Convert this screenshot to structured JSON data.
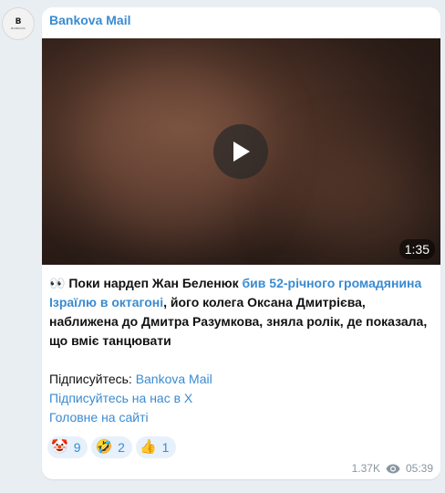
{
  "channel": {
    "sender": "Bankova Mail",
    "avatar_letter": "B",
    "avatar_text": "BANKOVA"
  },
  "video": {
    "duration": "1:35"
  },
  "post": {
    "emoji_lead": "👀",
    "lead_text": " Поки нардеп Жан Беленюк ",
    "link_text": "бив 52-річного громадянина Ізраїлю в октагоні",
    "rest_text": ", його колега Оксана Дмитрієва, наближена до Дмитра Разумкова, зняла ролік, де показала, що вміє танцювати",
    "subscribe_prefix": "Підписуйтесь: ",
    "subscribe_link": "Bankova Mail",
    "x_link": "Підписуйтесь на нас в X",
    "site_link": "Головне на сайті"
  },
  "reactions": [
    {
      "emoji": "🤡",
      "count": "9"
    },
    {
      "emoji": "🤣",
      "count": "2"
    },
    {
      "emoji": "👍",
      "count": "1"
    }
  ],
  "meta": {
    "views": "1.37K",
    "time": "05:39"
  }
}
